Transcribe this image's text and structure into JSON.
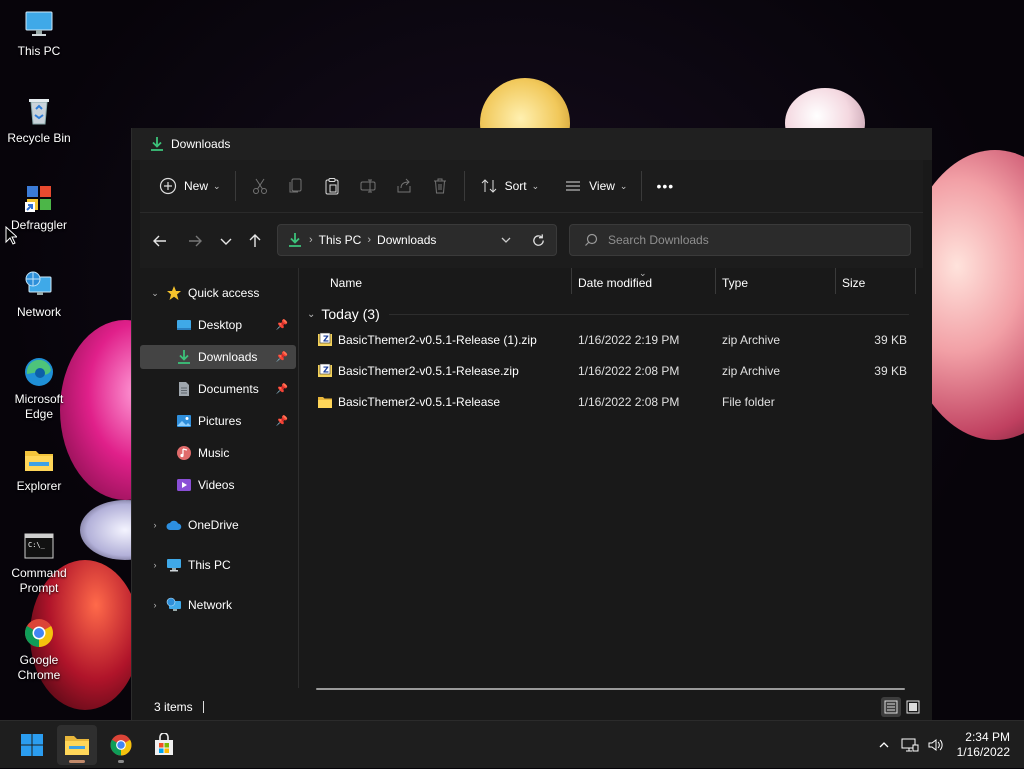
{
  "desktop": {
    "icons": [
      {
        "label": "This PC",
        "icon": "monitor-icon"
      },
      {
        "label": "Recycle Bin",
        "icon": "recycle-bin-icon"
      },
      {
        "label": "Defraggler",
        "icon": "defraggler-icon"
      },
      {
        "label": "Network",
        "icon": "network-icon"
      },
      {
        "label": "Microsoft Edge",
        "icon": "edge-icon"
      },
      {
        "label": "Explorer",
        "icon": "folder-icon"
      },
      {
        "label": "Command Prompt",
        "icon": "cmd-icon"
      },
      {
        "label": "Google Chrome",
        "icon": "chrome-icon"
      }
    ]
  },
  "window": {
    "title": "Downloads",
    "toolbar": {
      "new_label": "New",
      "sort_label": "Sort",
      "view_label": "View",
      "more_label": "•••"
    },
    "address": {
      "root": "This PC",
      "current": "Downloads",
      "search_placeholder": "Search Downloads"
    },
    "nav": {
      "quick_access": "Quick access",
      "items": [
        {
          "label": "Desktop",
          "icon": "desktop-icon",
          "pinned": true
        },
        {
          "label": "Downloads",
          "icon": "download-icon",
          "pinned": true
        },
        {
          "label": "Documents",
          "icon": "document-icon",
          "pinned": true
        },
        {
          "label": "Pictures",
          "icon": "pictures-icon",
          "pinned": true
        },
        {
          "label": "Music",
          "icon": "music-icon",
          "pinned": false
        },
        {
          "label": "Videos",
          "icon": "videos-icon",
          "pinned": false
        }
      ],
      "onedrive": "OneDrive",
      "this_pc": "This PC",
      "network": "Network",
      "pin_glyph": "📌"
    },
    "columns": {
      "name": "Name",
      "date": "Date modified",
      "type": "Type",
      "size": "Size"
    },
    "group": {
      "label": "Today (3)"
    },
    "files": [
      {
        "name": "BasicThemer2-v0.5.1-Release (1).zip",
        "date": "1/16/2022 2:19 PM",
        "type": "zip Archive",
        "size": "39 KB",
        "icon": "zip-icon"
      },
      {
        "name": "BasicThemer2-v0.5.1-Release.zip",
        "date": "1/16/2022 2:08 PM",
        "type": "zip Archive",
        "size": "39 KB",
        "icon": "zip-icon"
      },
      {
        "name": "BasicThemer2-v0.5.1-Release",
        "date": "1/16/2022 2:08 PM",
        "type": "File folder",
        "size": "",
        "icon": "folder-icon"
      }
    ],
    "status": {
      "item_count": "3 items"
    }
  },
  "taskbar": {
    "apps": [
      "start",
      "file-explorer",
      "chrome",
      "store"
    ],
    "time": "2:34 PM",
    "date": "1/16/2022"
  }
}
